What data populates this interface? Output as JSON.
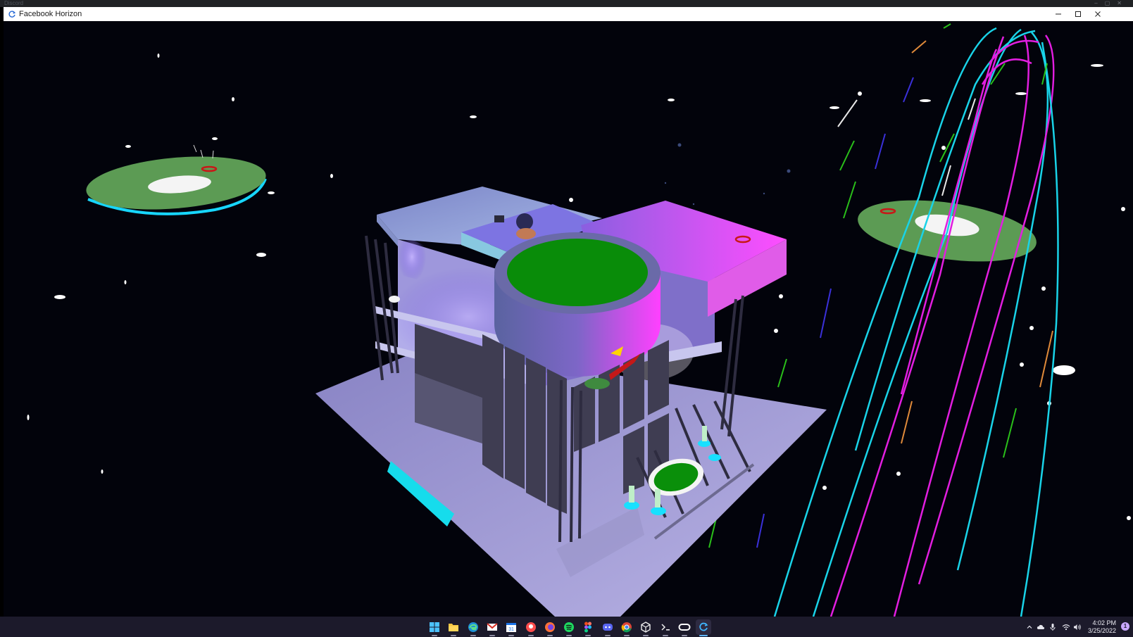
{
  "background_app": {
    "title": "Discord"
  },
  "window": {
    "title": "Facebook Horizon",
    "app_icon": "horizon-refresh-icon",
    "controls": {
      "minimize": "minimize-icon",
      "maximize": "maximize-icon",
      "close": "close-icon"
    }
  },
  "scene": {
    "description_icon": "3d-viewport",
    "colors": {
      "sky": "#02030b",
      "platform": "#5aa05a",
      "building": "#8a84c8",
      "magenta": "#ff3cff",
      "cyan": "#18e0ff",
      "green_pad": "#0a8f0a"
    }
  },
  "taskbar": {
    "icons": [
      {
        "name": "windows-start-icon",
        "active": false
      },
      {
        "name": "file-explorer-icon",
        "active": false
      },
      {
        "name": "edge-icon",
        "active": false
      },
      {
        "name": "gmail-icon",
        "active": false
      },
      {
        "name": "calendar-icon",
        "label": "31",
        "active": false
      },
      {
        "name": "gamepad-icon",
        "active": false
      },
      {
        "name": "firefox-icon",
        "active": false
      },
      {
        "name": "spotify-icon",
        "active": false
      },
      {
        "name": "figma-icon",
        "active": false
      },
      {
        "name": "discord-icon",
        "active": false
      },
      {
        "name": "chrome-icon",
        "active": false
      },
      {
        "name": "unity-icon",
        "active": false
      },
      {
        "name": "terminal-icon",
        "active": false
      },
      {
        "name": "oculus-icon",
        "active": false
      },
      {
        "name": "horizon-icon",
        "active": true
      }
    ],
    "tray": {
      "icons": [
        "chevron-up-icon",
        "cloud-icon",
        "microphone-icon",
        "wifi-icon",
        "volume-icon"
      ],
      "time": "4:02 PM",
      "date": "3/25/2022",
      "notification_count": "1"
    }
  }
}
